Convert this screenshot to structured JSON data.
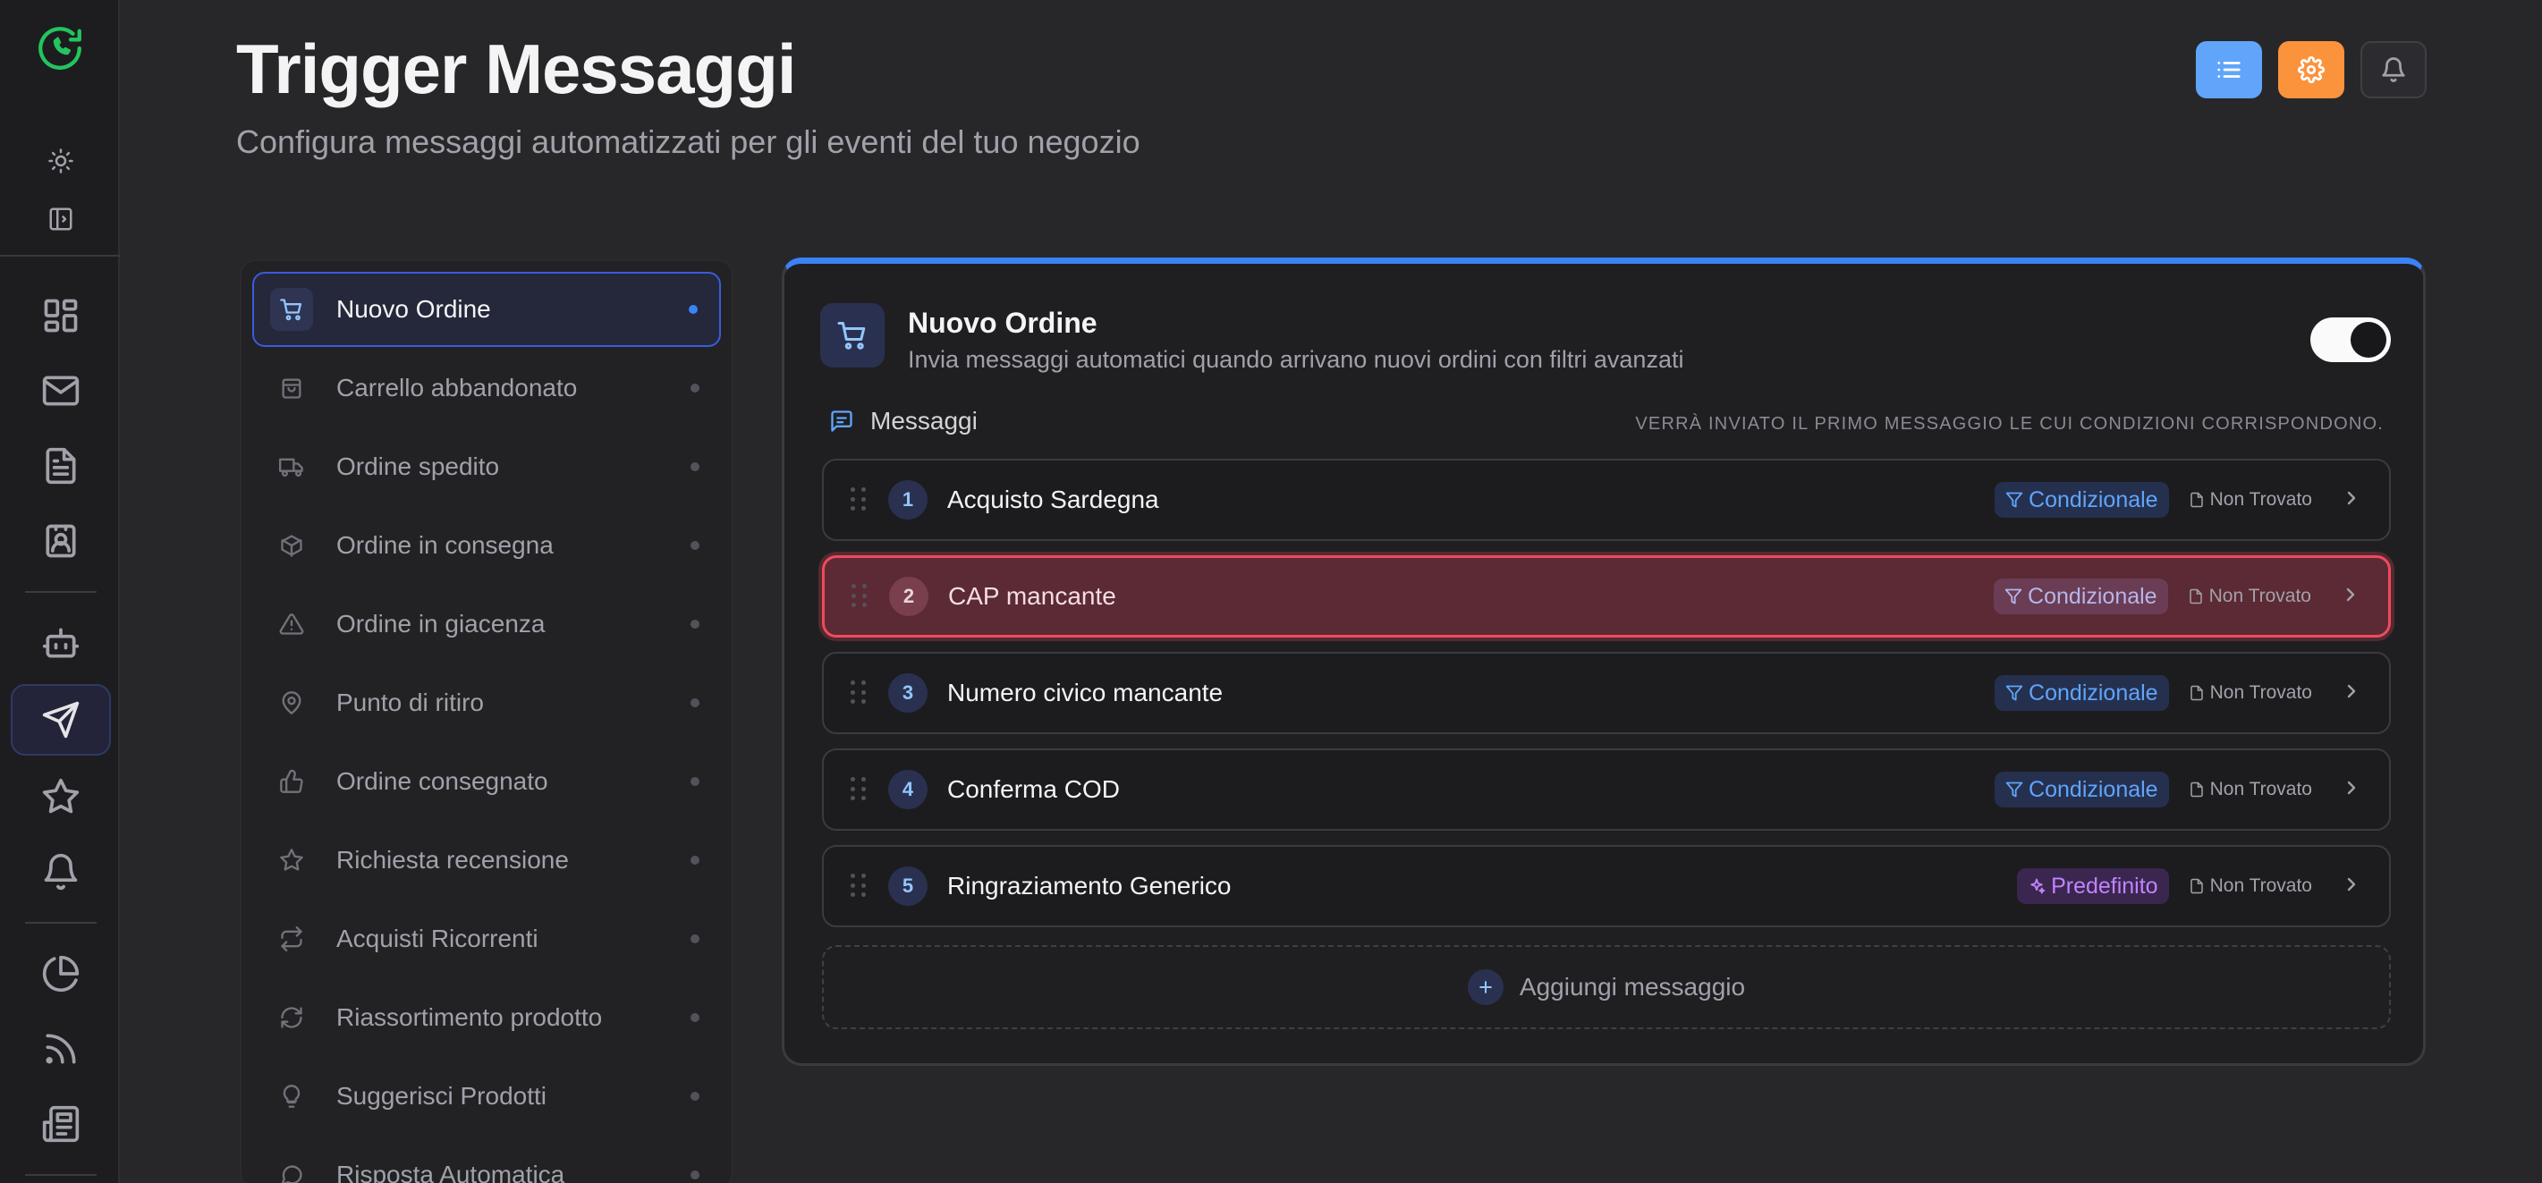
{
  "header": {
    "title": "Trigger Messaggi",
    "subtitle": "Configura messaggi automatizzati per gli eventi del tuo negozio",
    "buttons": [
      {
        "icon": "list-icon",
        "color": "#60a5fa"
      },
      {
        "icon": "gear-icon",
        "color": "#fb923c"
      },
      {
        "icon": "bell-icon",
        "color": "#2c2c30"
      }
    ]
  },
  "rail": {
    "items": [
      "logo-icon",
      "sun-icon",
      "panel-toggle-icon",
      "dashboard-icon",
      "mail-icon",
      "document-icon",
      "contact-card-icon",
      "bot-icon",
      "send-icon",
      "star-icon",
      "bell-icon",
      "pie-chart-icon",
      "rss-icon",
      "newspaper-icon"
    ],
    "active": "send-icon"
  },
  "triggers": [
    {
      "label": "Nuovo Ordine",
      "icon": "cart-icon",
      "active": true
    },
    {
      "label": "Carrello abbandonato",
      "icon": "bag-icon"
    },
    {
      "label": "Ordine spedito",
      "icon": "truck-icon"
    },
    {
      "label": "Ordine in consegna",
      "icon": "package-icon"
    },
    {
      "label": "Ordine in giacenza",
      "icon": "warning-icon"
    },
    {
      "label": "Punto di ritiro",
      "icon": "map-pin-icon"
    },
    {
      "label": "Ordine consegnato",
      "icon": "thumbs-up-icon"
    },
    {
      "label": "Richiesta recensione",
      "icon": "star-icon"
    },
    {
      "label": "Acquisti Ricorrenti",
      "icon": "repeat-icon"
    },
    {
      "label": "Riassortimento prodotto",
      "icon": "refresh-icon"
    },
    {
      "label": "Suggerisci Prodotti",
      "icon": "lightbulb-icon"
    },
    {
      "label": "Risposta Automatica",
      "icon": "chat-icon"
    }
  ],
  "card": {
    "title": "Nuovo Ordine",
    "description": "Invia messaggi automatici quando arrivano nuovi ordini con filtri avanzati",
    "enabled": true,
    "messages_label": "Messaggi",
    "hint": "VERRÀ INVIATO IL PRIMO MESSAGGIO LE CUI CONDIZIONI CORRISPONDONO.",
    "messages": [
      {
        "n": "1",
        "name": "Acquisto Sardegna",
        "badge": "Condizionale",
        "type": "cond",
        "status": "Non Trovato"
      },
      {
        "n": "2",
        "name": "CAP mancante",
        "badge": "Condizionale",
        "type": "cond",
        "status": "Non Trovato",
        "selected": true
      },
      {
        "n": "3",
        "name": "Numero civico mancante",
        "badge": "Condizionale",
        "type": "cond",
        "status": "Non Trovato"
      },
      {
        "n": "4",
        "name": "Conferma COD",
        "badge": "Condizionale",
        "type": "cond",
        "status": "Non Trovato"
      },
      {
        "n": "5",
        "name": "Ringraziamento Generico",
        "badge": "Predefinito",
        "type": "pre",
        "status": "Non Trovato"
      }
    ],
    "add_label": "Aggiungi messaggio"
  },
  "colors": {
    "accent": "#3b82f6",
    "highlight": "#ef4a5e",
    "orange": "#fb923c"
  }
}
